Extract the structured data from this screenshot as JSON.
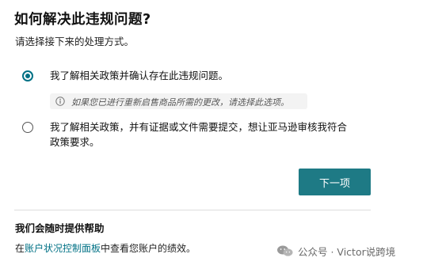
{
  "page": {
    "title": "如何解决此违规问题?",
    "subtitle": "请选择接下来的处理方式。"
  },
  "options": [
    {
      "label": "我了解相关政策并确认存在此违规问题。",
      "selected": true,
      "hint": "如果您已进行重新启售商品所需的更改，请选择此选项。"
    },
    {
      "label_line1": "我了解相关政策，并有证据或文件需要提交，想让亚马逊审核我符合",
      "label_line2": "政策要求。",
      "selected": false
    }
  ],
  "actions": {
    "next_label": "下一项",
    "accent_color": "#1e7a85"
  },
  "help": {
    "title": "我们会随时提供帮助",
    "prefix": "在",
    "link_text": "账户状况控制面板",
    "suffix": "中查看您账户的绩效。",
    "link_color": "#007185"
  },
  "watermark": {
    "text": "公众号 · Victor说跨境",
    "icon": "wechat-icon"
  }
}
